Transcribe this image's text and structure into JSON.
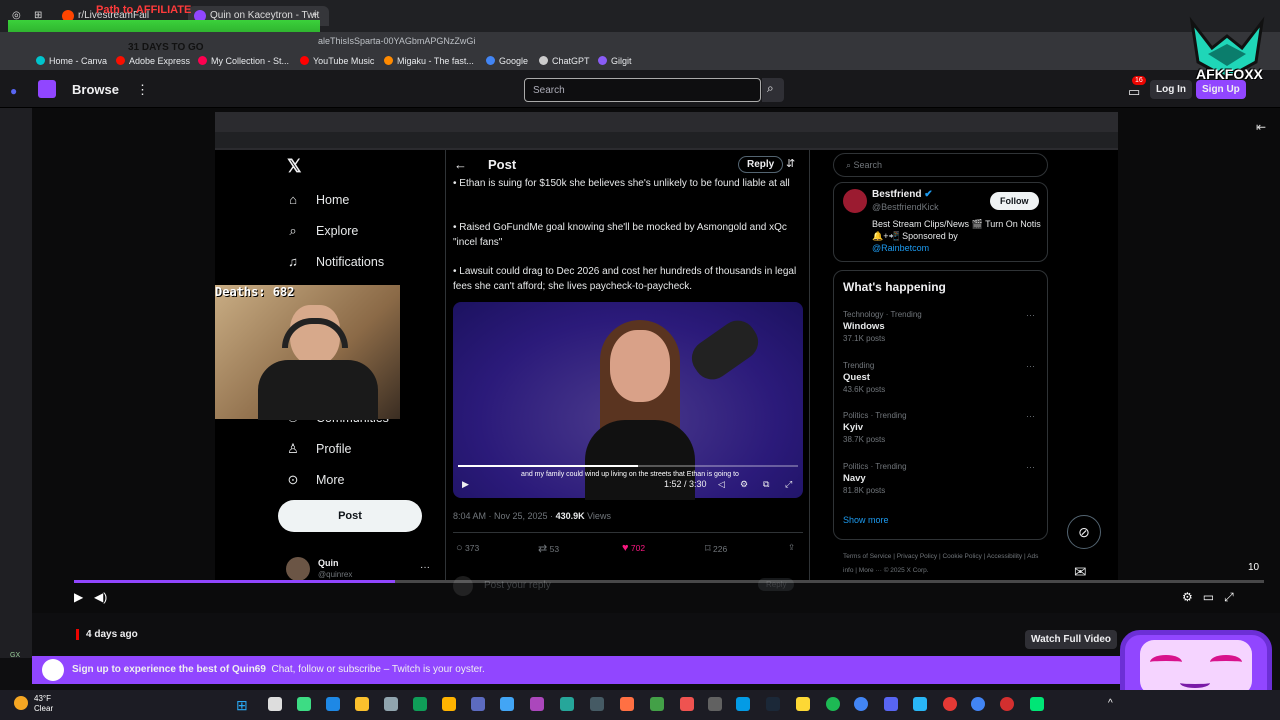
{
  "browser": {
    "tabs": [
      "r/LivestreamFail",
      "Quin on Kaceytron - Twit"
    ],
    "overlay_text": "Path to AFFILIATE",
    "slime_text": "31 DAYS TO GO",
    "url_fragment": "aleThisIsSparta-00YAGbmAPGNzZwGi",
    "bookmarks": [
      "Home - Canva",
      "Adobe Express",
      "My Collection - St...",
      "YouTube Music",
      "Migaku - The fast...",
      "Google",
      "ChatGPT",
      "Gilgit"
    ]
  },
  "twitch": {
    "browse": "Browse",
    "search_placeholder": "Search",
    "notif_count": "16",
    "login": "Log In",
    "signup": "Sign Up",
    "viewers": "10",
    "time_ago": "4 days ago",
    "watch_full": "Watch Full Video",
    "banner": {
      "lead": "Sign up to experience the best of Quin69",
      "rest": "Chat, follow or subscribe – Twitch is your oyster."
    },
    "progress_fraction": 0.27
  },
  "webcam": {
    "deaths": "Deaths: 682"
  },
  "x": {
    "nav": [
      "Home",
      "Explore",
      "Notifications",
      "Communities",
      "Profile",
      "More"
    ],
    "post_button": "Post",
    "header": "Post",
    "reply_header": "Reply",
    "post_lines": [
      "• Ethan is suing for $150k she believes she's unlikely to be found liable at all",
      "• Raised GoFundMe goal knowing she'll be mocked by Asmongold and xQc \"incel fans\"",
      "• Lawsuit could drag to Dec 2026 and cost her hundreds of thousands in legal fees she can't afford; she lives paycheck-to-paycheck."
    ],
    "video": {
      "subtitle": "and my family could wind up living on the streets that Ethan is going to",
      "time": "1:52 / 3:30",
      "progress_fraction": 0.53
    },
    "meta": {
      "time": "8:04 AM · Nov 25, 2025 · ",
      "views": "430.9K",
      "views_label": " Views"
    },
    "stats": {
      "replies": "373",
      "reposts": "53",
      "likes": "702",
      "bookmarks": "226"
    },
    "reply_placeholder": "Post your reply",
    "reply_btn": "Reply",
    "user": {
      "name": "Quin",
      "handle": "@quinrex"
    },
    "right": {
      "search_placeholder": "Search",
      "best": {
        "name": "Bestfriend",
        "handle": "@BestfriendKick",
        "bio": "Best Stream Clips/News 🎬 Turn On Notis 🔔+📲 Sponsored by",
        "link": "@Rainbetcom",
        "follow": "Follow"
      },
      "happening_title": "What's happening",
      "trends": [
        {
          "cat": "Technology · Trending",
          "name": "Windows",
          "posts": "37.1K posts"
        },
        {
          "cat": "Trending",
          "name": "Quest",
          "posts": "43.6K posts"
        },
        {
          "cat": "Politics · Trending",
          "name": "Kyiv",
          "posts": "38.7K posts"
        },
        {
          "cat": "Politics · Trending",
          "name": "Navy",
          "posts": "81.8K posts"
        }
      ],
      "show_more": "Show more",
      "footer": "Terms of Service | Privacy Policy | Cookie Policy | Accessibility | Ads info | More ··· © 2025 X Corp."
    }
  },
  "logo": {
    "text": "AFKFOXX"
  },
  "taskbar": {
    "temp": "43°F",
    "cond": "Clear"
  },
  "colors": {
    "twitch_purple": "#9146ff",
    "x_blue": "#1d9bf0",
    "like_pink": "#f91880"
  }
}
